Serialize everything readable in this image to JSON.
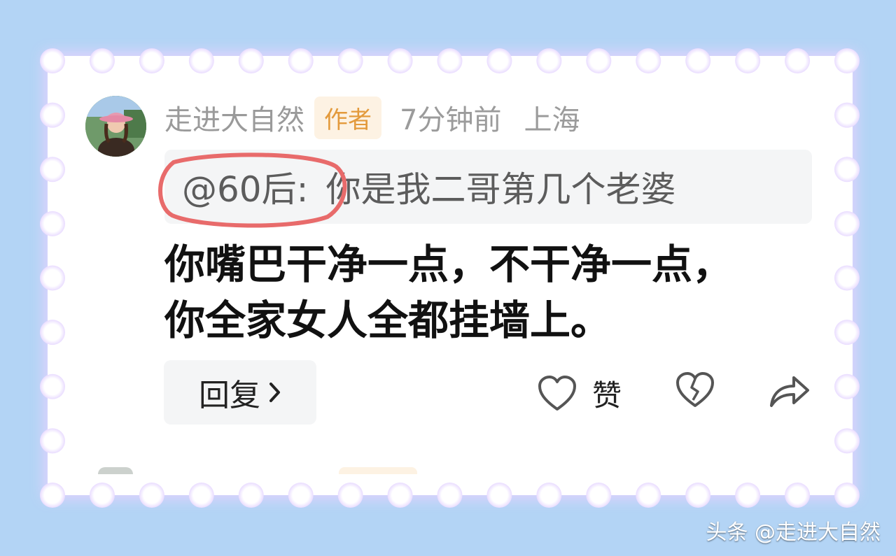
{
  "comment": {
    "author": "走进大自然",
    "author_badge": "作者",
    "time": "7分钟前",
    "location": "上海",
    "quote": {
      "mention": "@60后:",
      "text": "你是我二哥第几个老婆"
    },
    "body_lines": [
      "你嘴巴干净一点，不干净一点，",
      "你全家女人全都挂墙上。"
    ],
    "reply_label": "回复",
    "like_label": "赞"
  },
  "watermark": "头条 @走进大自然",
  "colors": {
    "background": "#b3d4f5",
    "card": "#ffffff",
    "badge_bg": "#fdf2e3",
    "badge_text": "#e39a3c",
    "highlight_circle": "#e86b6b"
  },
  "icons": {
    "reply_chevron": "chevron-right-icon",
    "like": "heart-outline-icon",
    "dislike": "broken-heart-icon",
    "share": "share-arrow-icon"
  }
}
